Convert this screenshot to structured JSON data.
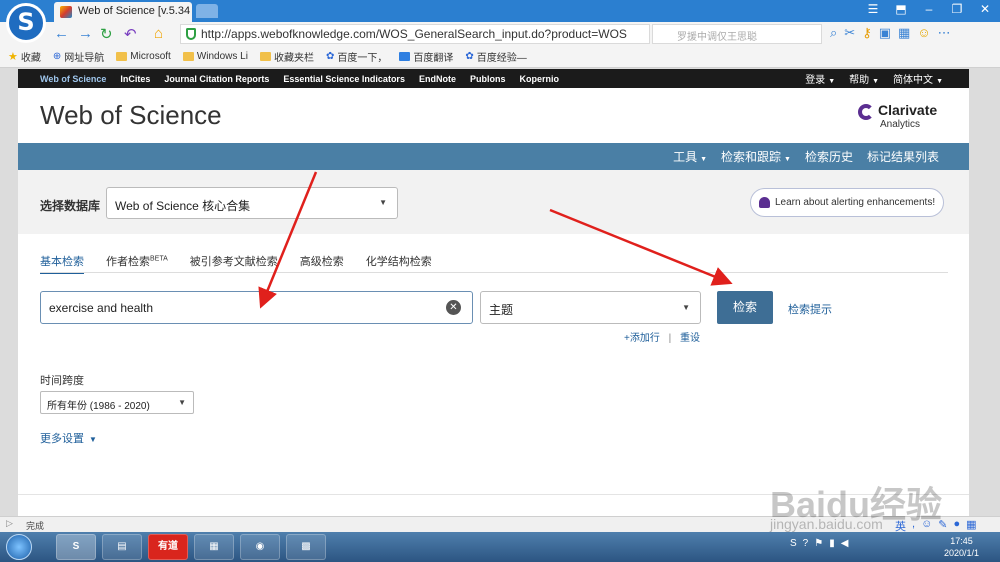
{
  "browser": {
    "tab_title": "Web of Science [v.5.34",
    "url": "http://apps.webofknowledge.com/WOS_GeneralSearch_input.do?product=WOS",
    "search_placeholder": "罗援中调仅王思聪",
    "bookmarks": [
      "收藏",
      "网址导航",
      "Microsoft",
      "Windows Li",
      "收藏夹栏",
      "百度一下，",
      "百度翻译",
      "百度经验—"
    ]
  },
  "topnav": {
    "items": [
      "Web of Science",
      "InCites",
      "Journal Citation Reports",
      "Essential Science Indicators",
      "EndNote",
      "Publons",
      "Kopernio"
    ],
    "right": [
      "登录",
      "帮助",
      "简体中文"
    ]
  },
  "header": {
    "title": "Web of Science",
    "brand_name": "Clarivate",
    "brand_sub": "Analytics"
  },
  "bluebar": [
    "工具",
    "检索和跟踪",
    "检索历史",
    "标记结果列表"
  ],
  "database": {
    "label": "选择数据库",
    "selected": "Web of Science 核心合集"
  },
  "alert_text": "Learn about alerting enhancements!",
  "search_tabs": {
    "items": [
      "基本检索",
      "作者检索",
      "被引参考文献检索",
      "高级检索",
      "化学结构检索"
    ],
    "beta": "BETA"
  },
  "search": {
    "query": "exercise and health",
    "field": "主题",
    "button": "检索",
    "tips": "检索提示",
    "add_row": "+添加行",
    "separator": "|",
    "reset": "重设"
  },
  "timespan": {
    "label": "时间跨度",
    "selected": "所有年份 (1986 - 2020)"
  },
  "more_settings": "更多设置",
  "status": "完成",
  "taskbar": {
    "youdao": "有道",
    "time": "17:45",
    "date": "2020/1/1",
    "ime": "英"
  },
  "watermark": {
    "main": "Baidu经验",
    "sub": "jingyan.baidu.com"
  },
  "colors": {
    "top_nav_bg": "#1b1b1b",
    "blue_bar": "#4a7fa5",
    "search_button": "#3e6e95",
    "link": "#1f5f9a",
    "arrow": "#e0201c"
  }
}
